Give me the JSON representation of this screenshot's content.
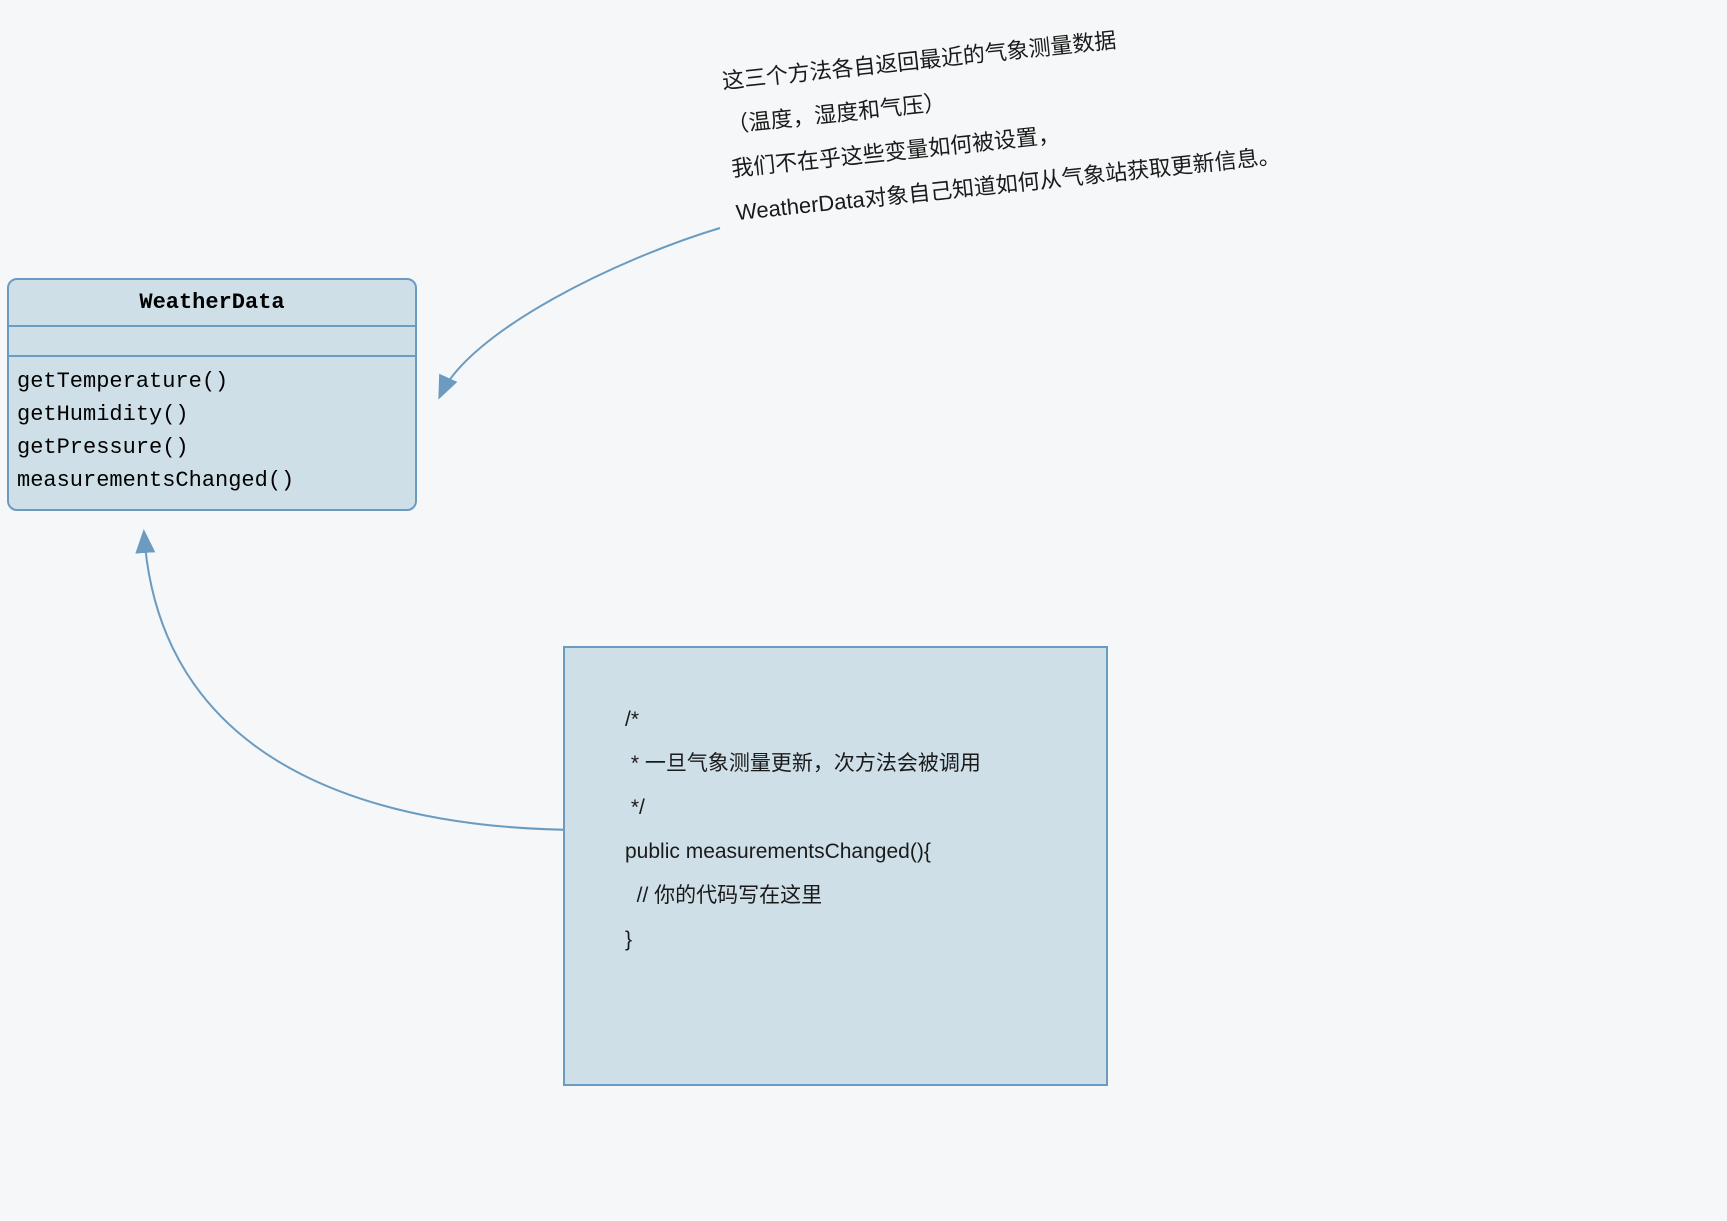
{
  "umlClass": {
    "title": "WeatherData",
    "methods": [
      "getTemperature()",
      "getHumidity()",
      "getPressure()",
      "measurementsChanged()"
    ]
  },
  "annotation": {
    "line1": "这三个方法各自返回最近的气象测量数据",
    "line2": "（温度，湿度和气压）",
    "line3": "我们不在乎这些变量如何被设置，",
    "line4": "WeatherData对象自己知道如何从气象站获取更新信息。"
  },
  "codeBox": {
    "line1": "/*",
    "line2": " * 一旦气象测量更新，次方法会被调用",
    "line3": " */",
    "line4": "public measurementsChanged(){",
    "line5": "  // 你的代码写在这里",
    "line6": "}"
  }
}
